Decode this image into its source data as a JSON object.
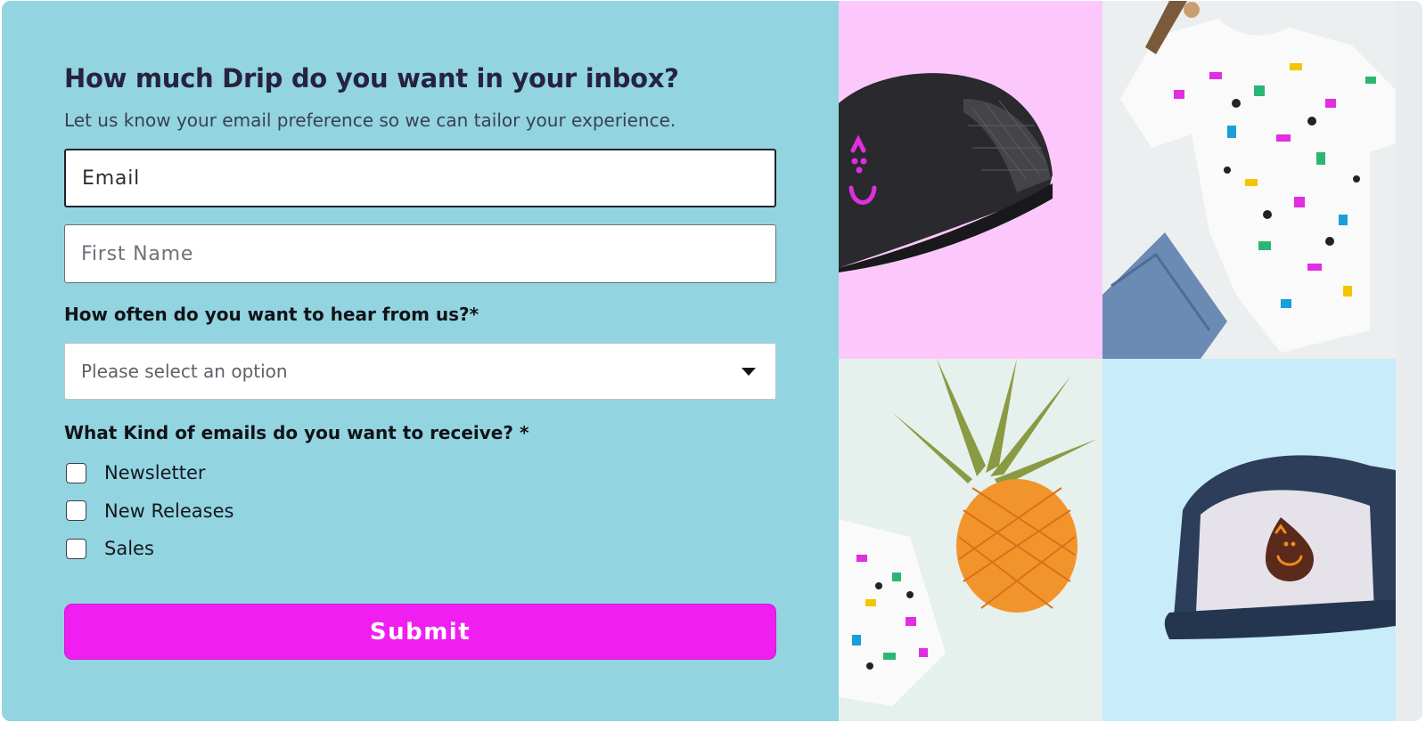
{
  "form": {
    "title": "How much Drip do you want in your inbox?",
    "subtitle": "Let us know your email preference so we can tailor your experience.",
    "email_placeholder": "Email",
    "first_name_placeholder": "First Name",
    "frequency_question": "How often do you want to hear from us?*",
    "frequency_select_value": "Please select an option",
    "kinds_question": "What Kind of emails do you want to receive? *",
    "options": [
      {
        "label": "Newsletter",
        "checked": false
      },
      {
        "label": "New Releases",
        "checked": false
      },
      {
        "label": "Sales",
        "checked": false
      }
    ],
    "submit_label": "Submit"
  },
  "gallery": {
    "images": [
      {
        "name": "black-cap-photo",
        "background": "#fcc8fc"
      },
      {
        "name": "printed-tshirt-photo",
        "background": "#eceff0"
      },
      {
        "name": "pineapple-mug-photo",
        "background": "#e6f0ec"
      },
      {
        "name": "navy-cap-photo",
        "background": "#c8ecfa"
      }
    ]
  },
  "colors": {
    "panel": "#93d4e1",
    "accent": "#f01ef0",
    "heading": "#26233f"
  }
}
